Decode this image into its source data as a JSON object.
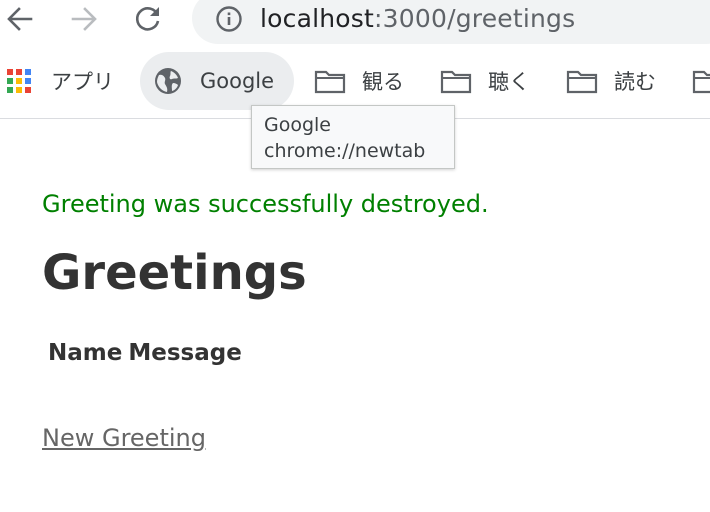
{
  "browser": {
    "back_icon": "arrow-left-icon",
    "forward_icon": "arrow-right-icon",
    "reload_icon": "reload-icon",
    "site_info_icon": "info-circle-icon",
    "url_host": "localhost",
    "url_path": ":3000/greetings"
  },
  "bookmarks": {
    "apps_label": "アプリ",
    "items": [
      {
        "label": "Google",
        "icon": "globe-icon"
      },
      {
        "label": "観る",
        "icon": "folder-icon"
      },
      {
        "label": "聴く",
        "icon": "folder-icon"
      },
      {
        "label": "読む",
        "icon": "folder-icon"
      }
    ],
    "tooltip": {
      "title": "Google",
      "url": "chrome://newtab"
    }
  },
  "page": {
    "notice": "Greeting was successfully destroyed.",
    "title": "Greetings",
    "table_headers": [
      "Name",
      "Message"
    ],
    "new_link": "New Greeting"
  },
  "colors": {
    "notice": "#008000",
    "heading": "#333333",
    "link": "#666666",
    "omnibox_bg": "#f1f3f4"
  }
}
